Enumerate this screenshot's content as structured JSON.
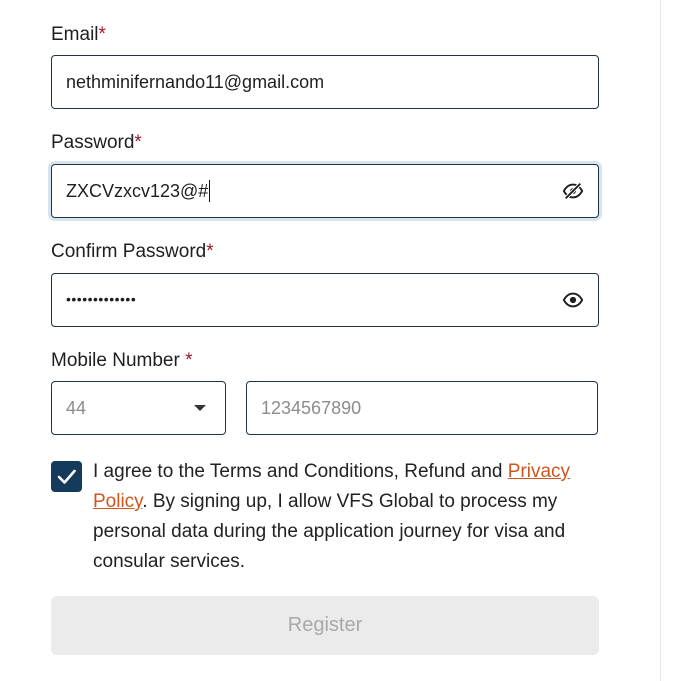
{
  "form": {
    "email": {
      "label": "Email",
      "required_mark": "*",
      "value": "nethminifernando11@gmail.com"
    },
    "password": {
      "label": "Password",
      "required_mark": "*",
      "value": "ZXCVzxcv123@#",
      "visibility_icon": "eye-slash-icon"
    },
    "confirm_password": {
      "label": "Confirm Password",
      "required_mark": "*",
      "masked_value": "•••••••••••••",
      "visibility_icon": "eye-icon"
    },
    "mobile": {
      "label": "Mobile Number",
      "required_mark": "*",
      "country_code": "44",
      "placeholder": "1234567890"
    },
    "consent": {
      "checked": true,
      "text_before": "I agree to the Terms and Conditions, Refund and ",
      "link_text": "Privacy Policy",
      "text_after": ". By signing up, I allow VFS Global to process my personal data during the application journey for visa and consular services."
    },
    "register_label": "Register"
  },
  "colors": {
    "input_border": "#1f3344",
    "required_star": "#a3182c",
    "checkbox_fill": "#143a5c",
    "link": "#d0561e",
    "button_disabled_bg": "#ebebeb",
    "button_disabled_text": "#a9a9a9"
  }
}
